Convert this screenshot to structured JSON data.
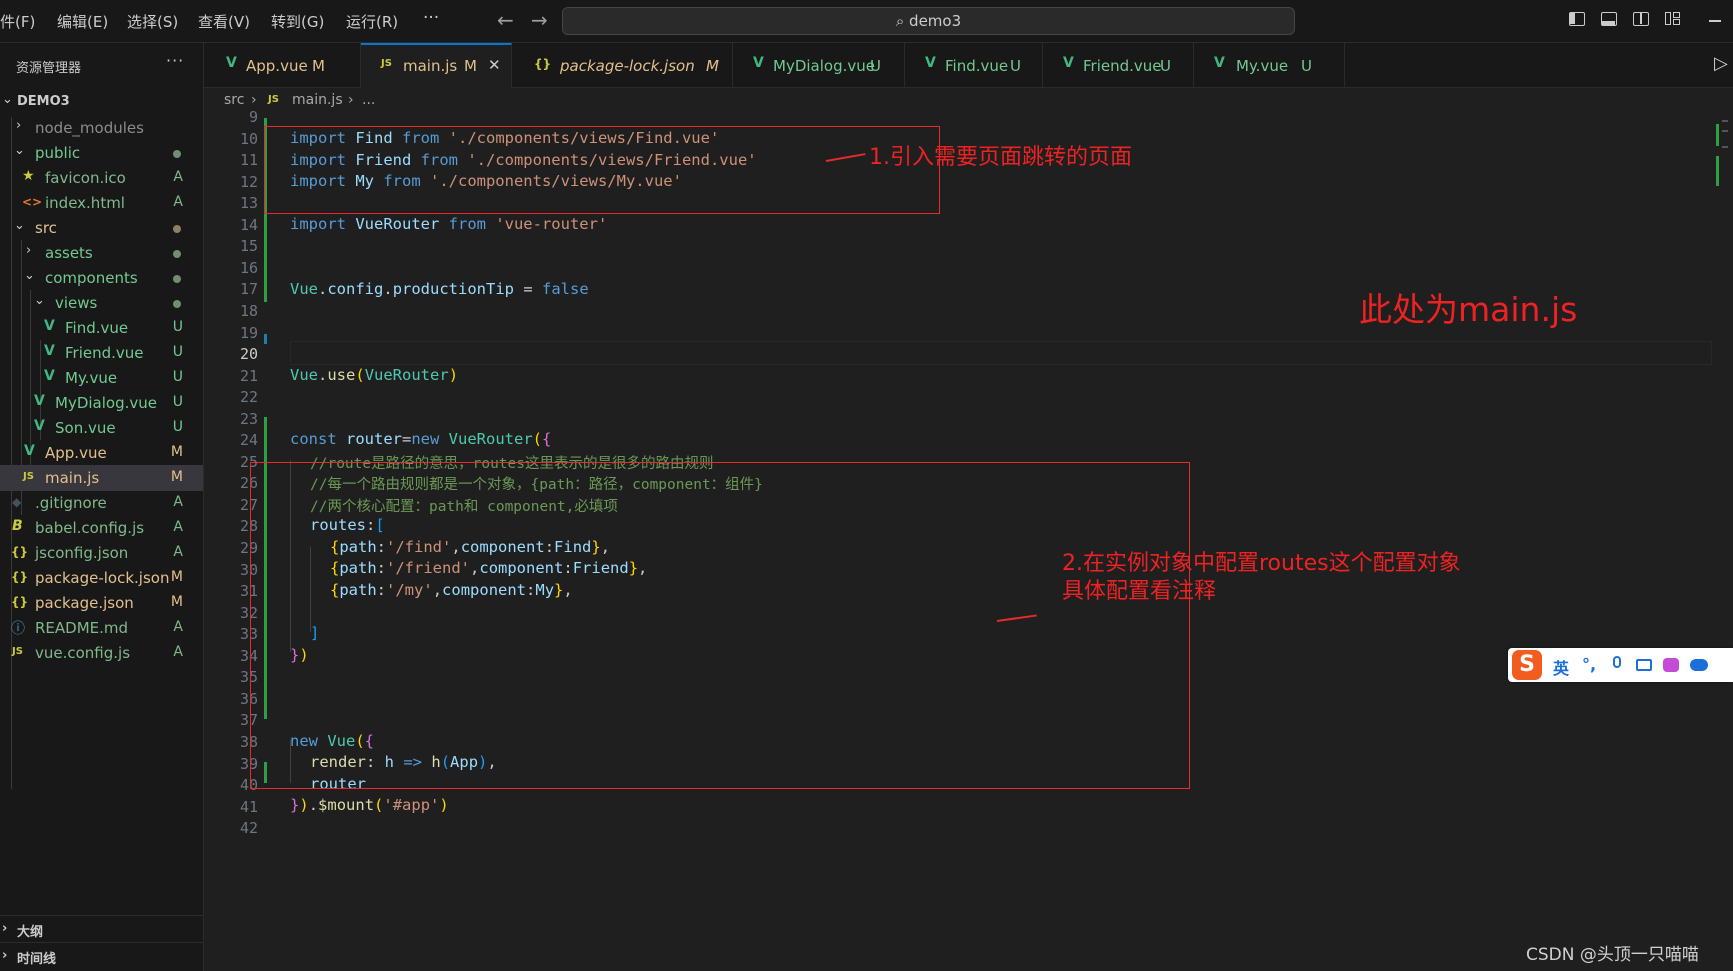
{
  "menu": [
    "件(F)",
    "编辑(E)",
    "选择(S)",
    "查看(V)",
    "转到(G)",
    "运行(R)"
  ],
  "menu_more": "···",
  "nav": {
    "back": "←",
    "forward": "→"
  },
  "command_center": {
    "search_icon": "⌕",
    "text": "demo3"
  },
  "sidebar": {
    "title": "资源管理器",
    "more": "···",
    "root": "DEMO3",
    "items": [
      {
        "label": "node_modules",
        "badge": "",
        "icon": ""
      },
      {
        "label": "public",
        "badge": "",
        "icon": ""
      },
      {
        "label": "favicon.ico",
        "badge": "A",
        "icon": "★"
      },
      {
        "label": "index.html",
        "badge": "A",
        "icon": "<>"
      },
      {
        "label": "src",
        "badge": "",
        "icon": ""
      },
      {
        "label": "assets",
        "badge": "",
        "icon": ""
      },
      {
        "label": "components",
        "badge": "",
        "icon": ""
      },
      {
        "label": "views",
        "badge": "",
        "icon": ""
      },
      {
        "label": "Find.vue",
        "badge": "U",
        "icon": "V"
      },
      {
        "label": "Friend.vue",
        "badge": "U",
        "icon": "V"
      },
      {
        "label": "My.vue",
        "badge": "U",
        "icon": "V"
      },
      {
        "label": "MyDialog.vue",
        "badge": "U",
        "icon": "V"
      },
      {
        "label": "Son.vue",
        "badge": "U",
        "icon": "V"
      },
      {
        "label": "App.vue",
        "badge": "M",
        "icon": "V"
      },
      {
        "label": "main.js",
        "badge": "M",
        "icon": "JS"
      },
      {
        "label": ".gitignore",
        "badge": "A",
        "icon": "◆"
      },
      {
        "label": "babel.config.js",
        "badge": "A",
        "icon": "B"
      },
      {
        "label": "jsconfig.json",
        "badge": "A",
        "icon": "{}"
      },
      {
        "label": "package-lock.json",
        "badge": "M",
        "icon": "{}"
      },
      {
        "label": "package.json",
        "badge": "M",
        "icon": "{}"
      },
      {
        "label": "README.md",
        "badge": "A",
        "icon": "ⓘ"
      },
      {
        "label": "vue.config.js",
        "badge": "A",
        "icon": "JS"
      }
    ],
    "outline": "大纲",
    "timeline": "时间线"
  },
  "tabs": [
    {
      "label": "App.vue",
      "status": "M",
      "icon": "V"
    },
    {
      "label": "main.js",
      "status": "M",
      "icon": "JS",
      "close": "✕"
    },
    {
      "label": "package-lock.json",
      "status": "M",
      "icon": "{}"
    },
    {
      "label": "MyDialog.vue",
      "status": "U",
      "icon": "V"
    },
    {
      "label": "Find.vue",
      "status": "U",
      "icon": "V"
    },
    {
      "label": "Friend.vue",
      "status": "U",
      "icon": "V"
    },
    {
      "label": "My.vue",
      "status": "U",
      "icon": "V"
    }
  ],
  "run_icon": "▷",
  "breadcrumb": {
    "folder": "src",
    "sep": "›",
    "icon": "JS",
    "file": "main.js",
    "more": "..."
  },
  "line_numbers": [
    "9",
    "10",
    "11",
    "12",
    "13",
    "14",
    "15",
    "16",
    "17",
    "18",
    "19",
    "20",
    "21",
    "22",
    "23",
    "24",
    "25",
    "26",
    "27",
    "28",
    "29",
    "30",
    "31",
    "32",
    "33",
    "34",
    "35",
    "36",
    "37",
    "38",
    "39",
    "40",
    "41",
    "42"
  ],
  "code": {
    "l10": {
      "a": "import",
      "b": " Find ",
      "c": "from",
      "d": " './components/views/Find.vue'"
    },
    "l11": {
      "a": "import",
      "b": " Friend ",
      "c": "from",
      "d": " './components/views/Friend.vue'"
    },
    "l12": {
      "a": "import",
      "b": " My ",
      "c": "from",
      "d": " './components/views/My.vue'"
    },
    "l14": {
      "a": "import",
      "b": " VueRouter ",
      "c": "from",
      "d": " 'vue-router'"
    },
    "l17": {
      "a": "Vue",
      "b": ".",
      "c": "config",
      "d": ".",
      "e": "productionTip",
      "f": " = ",
      "g": "false"
    },
    "l21": {
      "a": "Vue",
      "b": ".",
      "c": "use",
      "d": "(",
      "e": "VueRouter",
      "f": ")"
    },
    "l24": {
      "a": "const",
      "b": " router",
      "c": "=",
      "d": "new",
      "e": " VueRouter",
      "f": "(",
      "g": "{"
    },
    "l25": "//route是路径的意思，routes这里表示的是很多的路由规则",
    "l26": "//每一个路由规则都是一个对象，{path：路径，component：组件}",
    "l27": "//两个核心配置：path和 component,必填项",
    "l28": {
      "a": "routes",
      "b": ":",
      "c": "["
    },
    "l29": {
      "a": "{",
      "b": "path",
      "c": ":",
      "d": "'/find'",
      "e": ",",
      "f": "component",
      "g": ":",
      "h": "Find",
      "i": "}",
      "j": ","
    },
    "l30": {
      "a": "{",
      "b": "path",
      "c": ":",
      "d": "'/friend'",
      "e": ",",
      "f": "component",
      "g": ":",
      "h": "Friend",
      "i": "}",
      "j": ","
    },
    "l31": {
      "a": "{",
      "b": "path",
      "c": ":",
      "d": "'/my'",
      "e": ",",
      "f": "component",
      "g": ":",
      "h": "My",
      "i": "}",
      "j": ","
    },
    "l33": "]",
    "l34": {
      "a": "}",
      "b": ")"
    },
    "l38": {
      "a": "new",
      "b": " Vue",
      "c": "(",
      "d": "{"
    },
    "l39": {
      "a": "render",
      "b": ": ",
      "c": "h",
      "d": " => ",
      "e": "h",
      "f": "(",
      "g": "App",
      "h": ")",
      "i": ","
    },
    "l40": "router",
    "l41": {
      "a": "}",
      "b": ")",
      "c": ".",
      "d": "$mount",
      "e": "(",
      "f": "'#app'",
      "g": ")"
    }
  },
  "annotations": {
    "note1": "1.引入需要页面跳转的页面",
    "note2": "此处为main.js",
    "note3_line1": "2.在实例对象中配置routes这个配置对象",
    "note3_line2": "具体配置看注释"
  },
  "ime": {
    "lang": "英",
    "punct": "°,"
  },
  "watermark": "CSDN @头顶一只喵喵",
  "colors": {
    "annotation": "#e52b2b",
    "accent": "#0078d4",
    "vue_green": "#41b883",
    "js_yellow": "#cbcb41",
    "modified": "#e2c08d",
    "untracked": "#73c991",
    "added": "#81b88b"
  }
}
